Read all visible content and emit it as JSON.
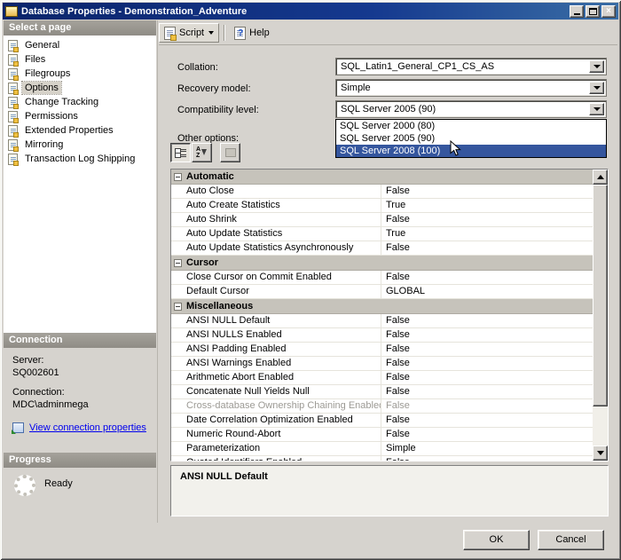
{
  "colors": {
    "titlebar_left": "#0a246a",
    "titlebar_right": "#3a6ea5",
    "highlight": "#35569e",
    "link": "#0000ee"
  },
  "window": {
    "title": "Database Properties - Demonstration_Adventure"
  },
  "icons": {
    "close": "×",
    "help_q": "?",
    "sort_a": "A",
    "sort_z": "Z"
  },
  "sidebar": {
    "header": "Select a page",
    "items": [
      {
        "label": "General",
        "selected": false
      },
      {
        "label": "Files",
        "selected": false
      },
      {
        "label": "Filegroups",
        "selected": false
      },
      {
        "label": "Options",
        "selected": true
      },
      {
        "label": "Change Tracking",
        "selected": false
      },
      {
        "label": "Permissions",
        "selected": false
      },
      {
        "label": "Extended Properties",
        "selected": false
      },
      {
        "label": "Mirroring",
        "selected": false
      },
      {
        "label": "Transaction Log Shipping",
        "selected": false
      }
    ]
  },
  "connection": {
    "header": "Connection",
    "server_label": "Server:",
    "server_value": "SQ002601",
    "connection_label": "Connection:",
    "connection_value": "MDC\\adminmega",
    "link": "View connection properties"
  },
  "progress": {
    "header": "Progress",
    "status": "Ready"
  },
  "toolbar": {
    "script_label": "Script",
    "help_label": "Help"
  },
  "form": {
    "collation_label": "Collation:",
    "collation_value": "SQL_Latin1_General_CP1_CS_AS",
    "recovery_label": "Recovery model:",
    "recovery_value": "Simple",
    "compat_label": "Compatibility level:",
    "compat_value": "SQL Server 2005 (90)",
    "other_options_label": "Other options:",
    "dropdown_options": [
      {
        "label": "SQL Server 2000 (80)",
        "highlighted": false
      },
      {
        "label": "SQL Server 2005 (90)",
        "highlighted": false
      },
      {
        "label": "SQL Server 2008 (100)",
        "highlighted": true
      }
    ]
  },
  "property_grid": {
    "groups": [
      {
        "name": "Automatic",
        "rows": [
          {
            "name": "Auto Close",
            "value": "False"
          },
          {
            "name": "Auto Create Statistics",
            "value": "True"
          },
          {
            "name": "Auto Shrink",
            "value": "False"
          },
          {
            "name": "Auto Update Statistics",
            "value": "True"
          },
          {
            "name": "Auto Update Statistics Asynchronously",
            "value": "False"
          }
        ]
      },
      {
        "name": "Cursor",
        "rows": [
          {
            "name": "Close Cursor on Commit Enabled",
            "value": "False"
          },
          {
            "name": "Default Cursor",
            "value": "GLOBAL"
          }
        ]
      },
      {
        "name": "Miscellaneous",
        "rows": [
          {
            "name": "ANSI NULL Default",
            "value": "False"
          },
          {
            "name": "ANSI NULLS Enabled",
            "value": "False"
          },
          {
            "name": "ANSI Padding Enabled",
            "value": "False"
          },
          {
            "name": "ANSI Warnings Enabled",
            "value": "False"
          },
          {
            "name": "Arithmetic Abort Enabled",
            "value": "False"
          },
          {
            "name": "Concatenate Null Yields Null",
            "value": "False"
          },
          {
            "name": "Cross-database Ownership Chaining Enabled",
            "value": "False",
            "disabled": true
          },
          {
            "name": "Date Correlation Optimization Enabled",
            "value": "False"
          },
          {
            "name": "Numeric Round-Abort",
            "value": "False"
          },
          {
            "name": "Parameterization",
            "value": "Simple"
          },
          {
            "name": "Quoted Identifiers Enabled",
            "value": "False"
          }
        ]
      }
    ]
  },
  "description": {
    "title": "ANSI NULL Default"
  },
  "footer": {
    "ok": "OK",
    "cancel": "Cancel"
  }
}
